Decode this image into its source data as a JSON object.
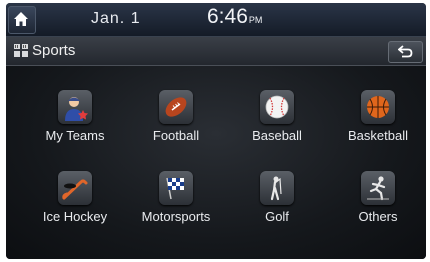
{
  "status_bar": {
    "date": "Jan. 1",
    "time": "6:46",
    "ampm": "PM",
    "home_icon": "home-icon"
  },
  "title_bar": {
    "title": "Sports",
    "title_icon": "grid-icon",
    "back_icon": "back-arrow-icon"
  },
  "menu": {
    "items": [
      {
        "label": "My Teams",
        "icon": "my-teams-icon"
      },
      {
        "label": "Football",
        "icon": "football-icon"
      },
      {
        "label": "Baseball",
        "icon": "baseball-icon"
      },
      {
        "label": "Basketball",
        "icon": "basketball-icon"
      },
      {
        "label": "Ice Hockey",
        "icon": "ice-hockey-icon"
      },
      {
        "label": "Motorsports",
        "icon": "motorsports-flag-icon"
      },
      {
        "label": "Golf",
        "icon": "golf-icon"
      },
      {
        "label": "Others",
        "icon": "others-icon"
      }
    ]
  },
  "colors": {
    "screen_bg": "#0f1217",
    "status_bar": "#1e2634",
    "title_bar": "#2e3239",
    "text": "#e9ebee"
  }
}
